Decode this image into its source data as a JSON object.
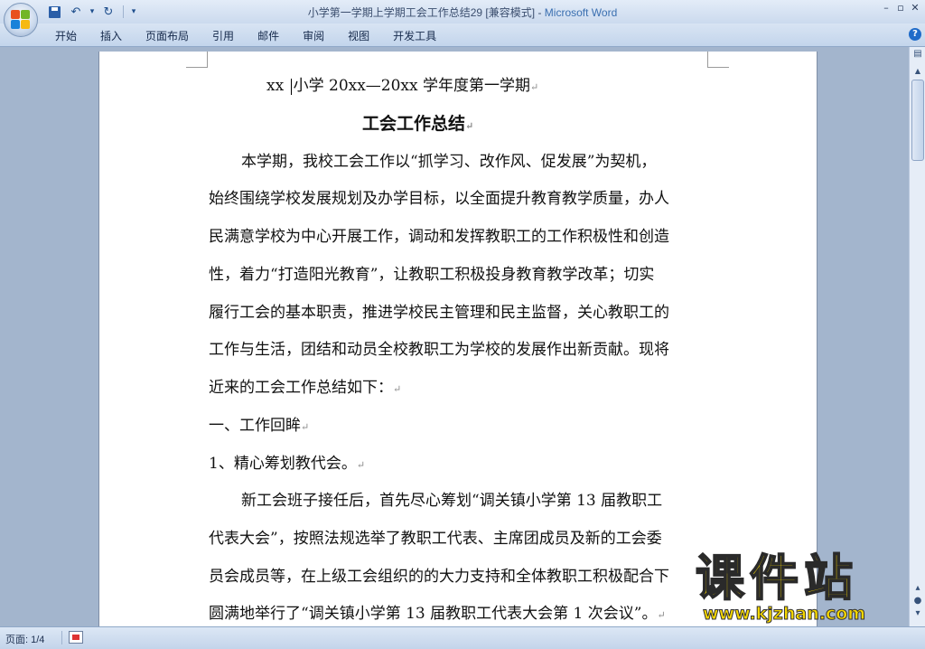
{
  "window": {
    "title_doc": "小学第一学期上学期工会工作总结29 [兼容模式]",
    "title_sep": " - ",
    "title_app": "Microsoft Word",
    "qat_more": "▾",
    "undo_glyph": "↶",
    "redo_glyph": "↻",
    "min": "–",
    "max": "▫",
    "close": "✕"
  },
  "ribbon": {
    "tabs": [
      "开始",
      "插入",
      "页面布局",
      "引用",
      "邮件",
      "审阅",
      "视图",
      "开发工具"
    ],
    "help": "?"
  },
  "document": {
    "lines": [
      "xx ",
      "小学 20xx—20xx 学年度第一学期",
      "工会工作总结",
      "本学期，我校工会工作以“抓学习、改作风、促发展”为契机，",
      "始终围绕学校发展规划及办学目标，以全面提升教育教学质量，办人",
      "民满意学校为中心开展工作，调动和发挥教职工的工作积极性和创造",
      "性，着力“打造阳光教育”，让教职工积极投身教育教学改革；切实",
      "履行工会的基本职责，推进学校民主管理和民主监督，关心教职工的",
      "工作与生活，团结和动员全校教职工为学校的发展作出新贡献。现将",
      "近来的工会工作总结如下：",
      "一、工作回眸",
      "1、精心筹划教代会。",
      "新工会班子接任后，首先尽心筹划“调关镇小学第 13 届教职工",
      "代表大会”，按照法规选举了教职工代表、主席团成员及新的工会委",
      "员会成员等，在上级工会组织的的大力支持和全体教职工积极配合下",
      "圆满地举行了“调关镇小学第 13 届教职工代表大会第 1 次会议”。"
    ],
    "para_mark": "↵"
  },
  "status": {
    "page": "页面: 1/4"
  },
  "watermark": {
    "text": "课件站",
    "url": "www.kjzhan.com"
  },
  "icons": {
    "office": "office-logo-icon",
    "save": "save-icon",
    "undo": "undo-icon",
    "redo": "redo-icon",
    "help": "help-icon",
    "proofing": "proofing-icon"
  }
}
